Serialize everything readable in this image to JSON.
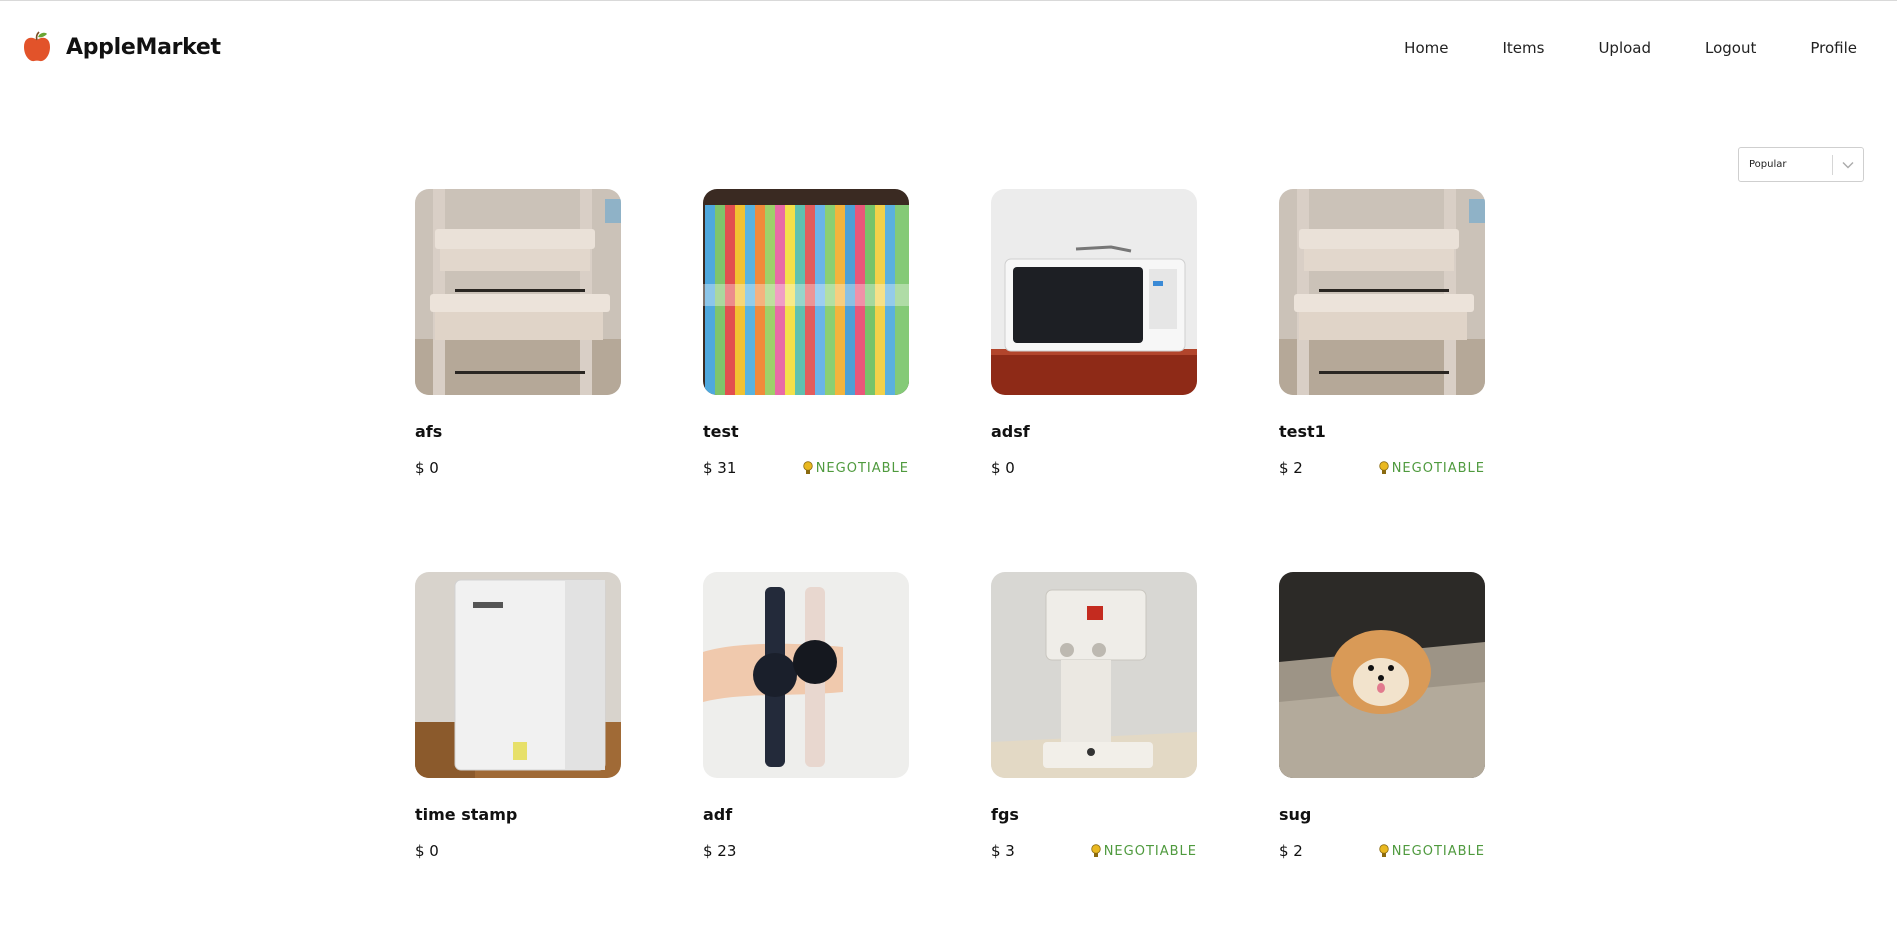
{
  "app": {
    "name": "AppleMarket",
    "logo_icon": "apple-icon"
  },
  "nav": [
    {
      "label": "Home"
    },
    {
      "label": "Items"
    },
    {
      "label": "Upload"
    },
    {
      "label": "Logout"
    },
    {
      "label": "Profile"
    }
  ],
  "sort": {
    "selected": "Popular",
    "icon": "chevron-down-icon"
  },
  "items": [
    {
      "title": "afs",
      "price": "$ 0",
      "negotiable": ""
    },
    {
      "title": "test",
      "price": "$ 31",
      "negotiable": "NEGOTIABLE"
    },
    {
      "title": "adsf",
      "price": "$ 0",
      "negotiable": ""
    },
    {
      "title": "test1",
      "price": "$ 2",
      "negotiable": "NEGOTIABLE"
    },
    {
      "title": "time stamp",
      "price": "$ 0",
      "negotiable": ""
    },
    {
      "title": "adf",
      "price": "$ 23",
      "negotiable": ""
    },
    {
      "title": "fgs",
      "price": "$ 3",
      "negotiable": "NEGOTIABLE"
    },
    {
      "title": "sug",
      "price": "$ 2",
      "negotiable": "NEGOTIABLE"
    }
  ],
  "colors": {
    "negotiable": "#4f9a3e",
    "bulb": "#e9b820",
    "logo_apple": "#e2532a",
    "logo_leaf": "#6aa533"
  }
}
